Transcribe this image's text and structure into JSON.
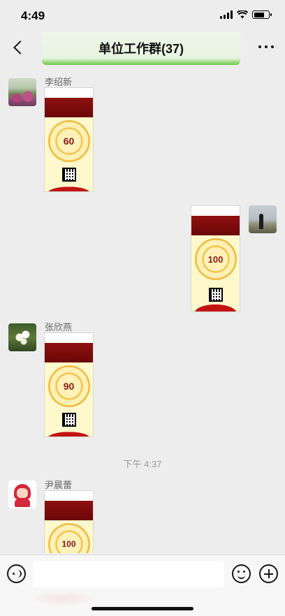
{
  "status_bar": {
    "time": "4:49"
  },
  "nav": {
    "title": "单位工作群(37)"
  },
  "messages": [
    {
      "sender": "李绍新",
      "score": "60"
    },
    {
      "sender": "",
      "score": "100"
    },
    {
      "sender": "张欣燕",
      "score": "90"
    },
    {
      "timestamp": "下午 4:37"
    },
    {
      "sender": "尹晨蕾",
      "score": "100"
    }
  ],
  "input": {
    "placeholder": ""
  },
  "colors": {
    "accent_green": "#74c94f",
    "background": "#ededed",
    "medal_gold": "#f0bc44",
    "header_red": "#8e1010"
  }
}
